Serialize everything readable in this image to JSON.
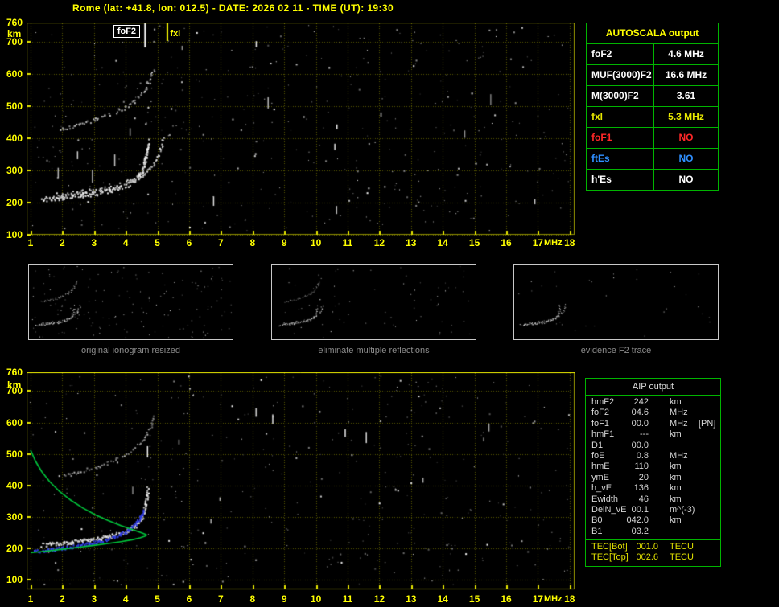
{
  "title": "Rome (lat: +41.8, lon: 012.5) - DATE: 2026 02 11 - TIME (UT): 19:30",
  "axes": {
    "y_ticks": [
      "760",
      "700",
      "600",
      "500",
      "400",
      "300",
      "200",
      "100"
    ],
    "y_values": [
      760,
      700,
      600,
      500,
      400,
      300,
      200,
      100
    ],
    "y_unit": "km",
    "x_ticks": [
      "1",
      "2",
      "3",
      "4",
      "5",
      "6",
      "7",
      "8",
      "9",
      "10",
      "11",
      "12",
      "13",
      "14",
      "15",
      "16",
      "17",
      "18"
    ],
    "x_values": [
      1,
      2,
      3,
      4,
      5,
      6,
      7,
      8,
      9,
      10,
      11,
      12,
      13,
      14,
      15,
      16,
      17,
      18
    ],
    "x_unit": "MHz"
  },
  "autoscala": {
    "title": "AUTOSCALA output",
    "rows": [
      {
        "label": "foF2",
        "value": "4.6 MHz",
        "color": "#ffffff"
      },
      {
        "label": "MUF(3000)F2",
        "value": "16.6 MHz",
        "color": "#ffffff"
      },
      {
        "label": "M(3000)F2",
        "value": "3.61",
        "color": "#ffffff"
      },
      {
        "label": "fxl",
        "value": "5.3 MHz",
        "color": "#e8e800"
      },
      {
        "label": "foF1",
        "value": "NO",
        "color": "#ff2828"
      },
      {
        "label": "ftEs",
        "value": "NO",
        "color": "#2f8fff"
      },
      {
        "label": "h'Es",
        "value": "NO",
        "color": "#ffffff"
      }
    ]
  },
  "thumbnails": [
    {
      "caption": "original ionogram resized"
    },
    {
      "caption": "eliminate multiple reflections"
    },
    {
      "caption": "evidence F2 trace"
    }
  ],
  "aip": {
    "title": "AIP output",
    "rows": [
      {
        "label": "hmF2",
        "value": "242",
        "unit": "km",
        "extra": ""
      },
      {
        "label": "foF2",
        "value": "04.6",
        "unit": "MHz",
        "extra": ""
      },
      {
        "label": "foF1",
        "value": "00.0",
        "unit": "MHz",
        "extra": "[PN]"
      },
      {
        "label": "hmF1",
        "value": "---",
        "unit": "km",
        "extra": ""
      },
      {
        "label": "D1",
        "value": "00.0",
        "unit": "",
        "extra": ""
      },
      {
        "label": "foE",
        "value": "0.8",
        "unit": "MHz",
        "extra": ""
      },
      {
        "label": "hmE",
        "value": "110",
        "unit": "km",
        "extra": ""
      },
      {
        "label": "ymE",
        "value": "20",
        "unit": "km",
        "extra": ""
      },
      {
        "label": "h_vE",
        "value": "136",
        "unit": "km",
        "extra": ""
      },
      {
        "label": "Ewidth",
        "value": "46",
        "unit": "km",
        "extra": ""
      },
      {
        "label": "DelN_vE",
        "value": "00.1",
        "unit": "m^(-3)",
        "extra": ""
      },
      {
        "label": "B0",
        "value": "042.0",
        "unit": "km",
        "extra": ""
      },
      {
        "label": "B1",
        "value": "03.2",
        "unit": "",
        "extra": ""
      }
    ],
    "tec_rows": [
      {
        "label": "TEC[Bot]",
        "value": "001.0",
        "unit": "TECU"
      },
      {
        "label": "TEC[Top]",
        "value": "002.6",
        "unit": "TECU"
      }
    ]
  },
  "chart_data": {
    "type": "scatter",
    "description": "Vertical-incidence ionogram: echo virtual height (km) vs sounding frequency (MHz), with AUTOSCALA restored trace and electron density profile",
    "traces": {
      "f2_ordinary": {
        "name": "F2 layer trace (O-mode)",
        "color": "#ffffff",
        "points": [
          [
            1.35,
            212
          ],
          [
            1.7,
            215
          ],
          [
            2.0,
            218
          ],
          [
            2.3,
            221
          ],
          [
            2.6,
            225
          ],
          [
            2.9,
            229
          ],
          [
            3.2,
            234
          ],
          [
            3.5,
            240
          ],
          [
            3.8,
            248
          ],
          [
            4.05,
            258
          ],
          [
            4.25,
            270
          ],
          [
            4.4,
            284
          ],
          [
            4.5,
            300
          ],
          [
            4.57,
            320
          ],
          [
            4.62,
            342
          ],
          [
            4.66,
            366
          ],
          [
            4.69,
            392
          ]
        ]
      },
      "f2_extraordinary": {
        "name": "F2 layer trace (X-mode)",
        "color": "#d8d8d8",
        "points": [
          [
            1.8,
            226
          ],
          [
            2.2,
            230
          ],
          [
            2.6,
            235
          ],
          [
            3.0,
            241
          ],
          [
            3.4,
            248
          ],
          [
            3.8,
            258
          ],
          [
            4.1,
            268
          ],
          [
            4.4,
            282
          ],
          [
            4.65,
            300
          ],
          [
            4.85,
            322
          ],
          [
            5.0,
            348
          ],
          [
            5.1,
            375
          ],
          [
            5.17,
            400
          ]
        ]
      },
      "f2_second_hop": {
        "name": "F2 multiple reflection (2nd hop)",
        "color": "#b4b4b4",
        "points": [
          [
            1.9,
            428
          ],
          [
            2.2,
            436
          ],
          [
            2.5,
            444
          ],
          [
            2.8,
            452
          ],
          [
            3.1,
            461
          ],
          [
            3.4,
            472
          ],
          [
            3.7,
            485
          ],
          [
            4.0,
            500
          ],
          [
            4.25,
            517
          ],
          [
            4.45,
            536
          ],
          [
            4.6,
            556
          ],
          [
            4.72,
            578
          ],
          [
            4.82,
            602
          ],
          [
            4.88,
            618
          ]
        ]
      },
      "autoscala_trace": {
        "name": "AUTOSCALA restored trace",
        "color": "#4646ff",
        "points": [
          [
            1.1,
            191
          ],
          [
            1.45,
            195
          ],
          [
            1.8,
            199
          ],
          [
            2.15,
            204
          ],
          [
            2.5,
            210
          ],
          [
            2.85,
            216
          ],
          [
            3.2,
            224
          ],
          [
            3.55,
            234
          ],
          [
            3.85,
            247
          ],
          [
            4.1,
            262
          ],
          [
            4.3,
            280
          ],
          [
            4.45,
            300
          ],
          [
            4.55,
            322
          ]
        ]
      },
      "density_profile": {
        "name": "Electron density profile N(h)",
        "color": "#00c83c",
        "points": [
          [
            1.0,
            512
          ],
          [
            1.15,
            478
          ],
          [
            1.35,
            444
          ],
          [
            1.6,
            412
          ],
          [
            1.9,
            382
          ],
          [
            2.25,
            354
          ],
          [
            2.65,
            328
          ],
          [
            3.05,
            306
          ],
          [
            3.45,
            288
          ],
          [
            3.85,
            272
          ],
          [
            4.2,
            260
          ],
          [
            4.45,
            251
          ],
          [
            4.6,
            245
          ],
          [
            4.66,
            242
          ],
          [
            4.6,
            238
          ],
          [
            4.45,
            233
          ],
          [
            4.2,
            227
          ],
          [
            3.85,
            221
          ],
          [
            3.45,
            215
          ],
          [
            3.0,
            209
          ],
          [
            2.5,
            203
          ],
          [
            2.0,
            197
          ],
          [
            1.5,
            191
          ],
          [
            1.1,
            187
          ],
          [
            1.0,
            186
          ]
        ]
      }
    },
    "plots": [
      {
        "id": "main-ionogram",
        "canvas": "top-canvas",
        "xlabel": "MHz",
        "ylabel": "km",
        "xlim": [
          1,
          18
        ],
        "ylim": [
          100,
          760
        ],
        "grid": true,
        "series": [
          {
            "trace": "f2_second_hop",
            "mode": "dots",
            "spread": 5,
            "density": 1,
            "size": 2,
            "bright": [
              115,
              215
            ],
            "p": 0.75
          },
          {
            "trace": "f2_ordinary",
            "mode": "dots",
            "spread": 6,
            "density": 2,
            "size": 2,
            "bright": [
              185,
              255
            ],
            "p": 0.9
          },
          {
            "trace": "f2_extraordinary",
            "mode": "dots",
            "spread": 5,
            "density": 1,
            "size": 2,
            "bright": [
              160,
              245
            ],
            "p": 0.85
          }
        ],
        "markers": [
          {
            "label": "foF2",
            "x": 4.6,
            "color": "#ffffff",
            "boxed": true,
            "len": 30
          },
          {
            "label": "fxl",
            "x": 5.3,
            "color": "#ffff00",
            "boxed": false,
            "len": 22
          }
        ],
        "noise": {
          "seed": 101,
          "speckles": 430,
          "dashes": 16
        }
      },
      {
        "id": "profile-ionogram",
        "canvas": "bottom-canvas",
        "xlabel": "MHz",
        "ylabel": "km",
        "xlim": [
          1,
          18
        ],
        "ylim": [
          100,
          760
        ],
        "grid": true,
        "series": [
          {
            "trace": "f2_second_hop",
            "mode": "dots",
            "spread": 4,
            "density": 1,
            "size": 2,
            "bright": [
              100,
              195
            ],
            "p": 0.7
          },
          {
            "trace": "f2_ordinary",
            "mode": "dots",
            "spread": 5,
            "density": 2,
            "size": 2,
            "bright": [
              175,
              255
            ],
            "p": 0.88
          },
          {
            "trace": "autoscala_trace",
            "mode": "dots-blue",
            "spread": 4,
            "density": 2,
            "size": 2,
            "bright": [
              120,
              255
            ],
            "p": 0.85
          },
          {
            "trace": "density_profile",
            "mode": "line",
            "width": 1.6
          }
        ],
        "noise": {
          "seed": 202,
          "speckles": 380,
          "dashes": 13
        }
      }
    ],
    "thumbnails": [
      {
        "seed": 11,
        "noise": 150,
        "series": [
          {
            "trace": "f2_ordinary",
            "bright": [
              185,
              255
            ]
          },
          {
            "trace": "f2_extraordinary",
            "bright": [
              150,
              230
            ]
          },
          {
            "trace": "f2_second_hop",
            "bright": [
              120,
              210
            ]
          }
        ]
      },
      {
        "seed": 12,
        "noise": 70,
        "series": [
          {
            "trace": "f2_ordinary",
            "bright": [
              185,
              255
            ]
          },
          {
            "trace": "f2_extraordinary",
            "bright": [
              150,
              230
            ]
          },
          {
            "trace": "f2_second_hop",
            "bright": [
              90,
              150
            ]
          }
        ]
      },
      {
        "seed": 13,
        "noise": 30,
        "series": [
          {
            "trace": "f2_ordinary",
            "bright": [
              200,
              255
            ]
          },
          {
            "trace": "f2_extraordinary",
            "bright": [
              150,
              230
            ]
          }
        ]
      }
    ]
  }
}
